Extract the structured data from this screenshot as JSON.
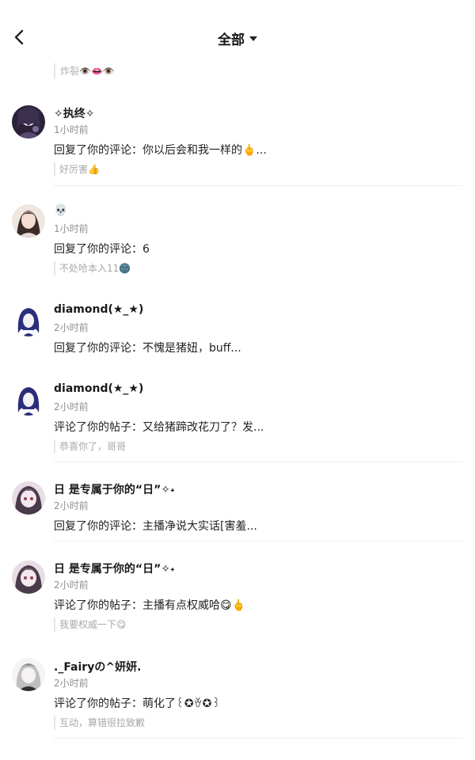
{
  "header": {
    "title": "全部",
    "back_icon": "chevron-left-icon",
    "dropdown_icon": "caret-down-icon"
  },
  "top_quote": {
    "text": "炸裂👁️👄👁️"
  },
  "items": [
    {
      "name": "✧执终✧",
      "time": "1小时前",
      "message": "回复了你的评论：你以后会和我一样的🖕...",
      "quote": "好厉害👍"
    },
    {
      "name": "💀",
      "time": "1小时前",
      "message": "回复了你的评论：6",
      "quote": "不处哈本入11🌚"
    },
    {
      "name": "diamond(★_★)",
      "time": "2小时前",
      "message": "回复了你的评论：不愧是猪妞，buff...",
      "quote": ""
    },
    {
      "name": "diamond(★_★)",
      "time": "2小时前",
      "message": "评论了你的帖子：又给猪蹄改花刀了？发...",
      "quote": "恭喜你了，哥哥"
    },
    {
      "name": "日 是专属于你的“日”✧˖",
      "time": "2小时前",
      "message": "回复了你的评论：主播净说大实话[害羞...",
      "quote": ""
    },
    {
      "name": "日 是专属于你的“日”✧˖",
      "time": "2小时前",
      "message": "评论了你的帖子：主播有点权威哈😋🖕",
      "quote": "我要权威一下😋"
    },
    {
      "name": "._Fairyの^妍妍.",
      "time": "2小时前",
      "message": "评论了你的帖子：萌化了꒰✪ꈊ✪꒱",
      "quote": "互动，算错很拉致歉"
    }
  ],
  "colors": {
    "background": "#ffffff",
    "divider": "#ececec",
    "secondary_text": "#8f8f8f",
    "quote_text": "#a8a8a8"
  }
}
